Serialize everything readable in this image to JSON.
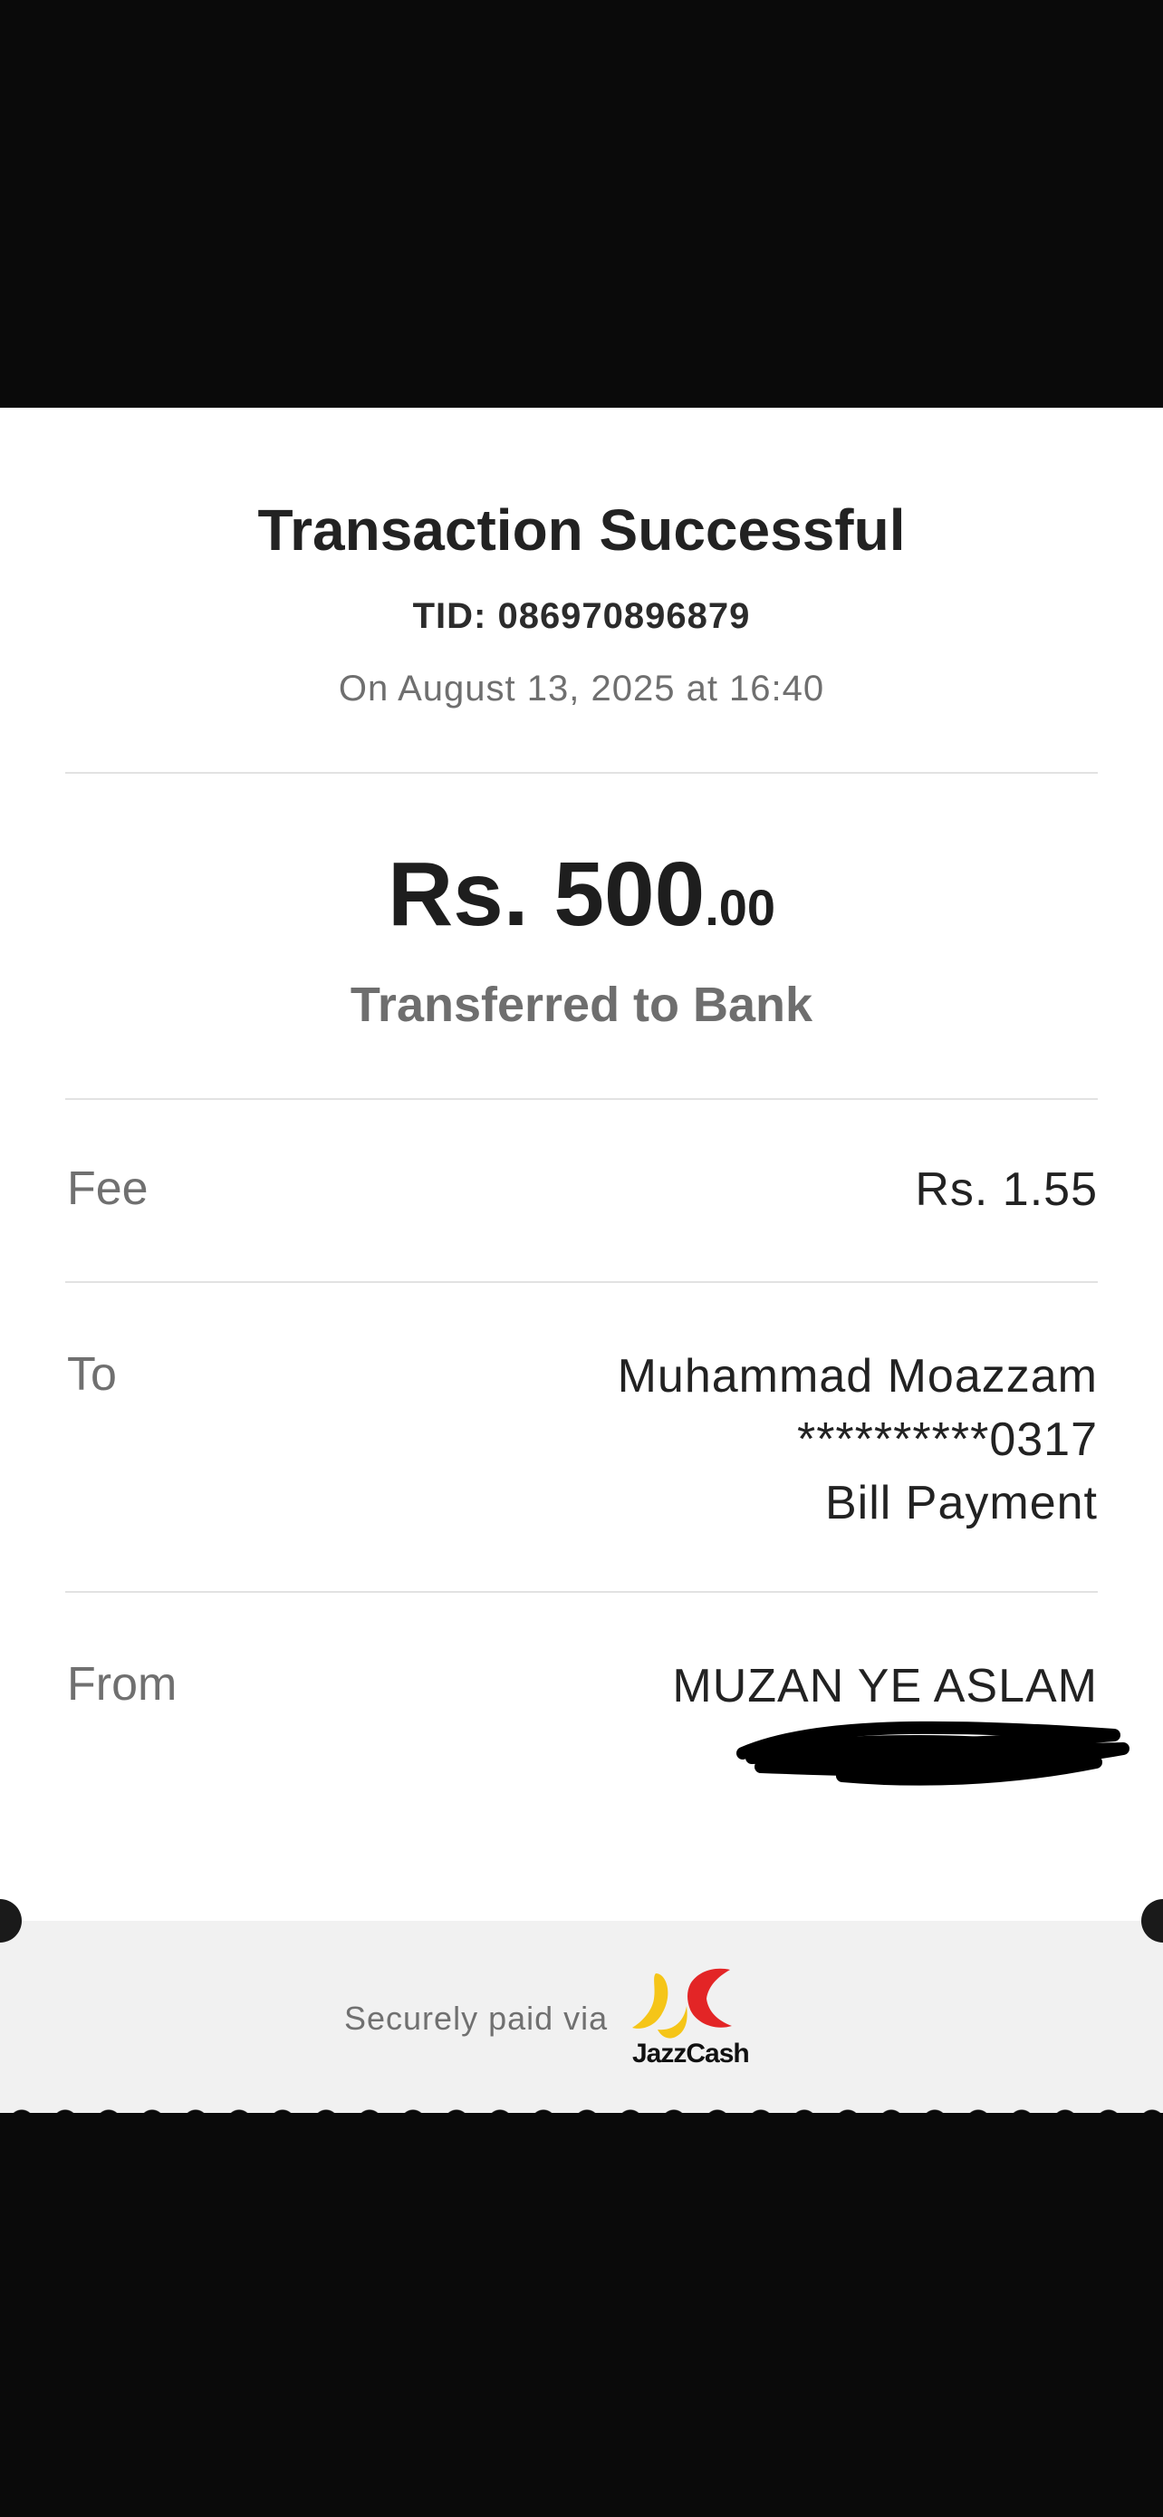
{
  "receipt": {
    "title": "Transaction Successful",
    "tid": "TID: 086970896879",
    "date": "On August 13, 2025 at 16:40",
    "amount_main": "Rs. 500",
    "amount_cents": ".00",
    "subtitle": "Transferred to Bank",
    "fee": {
      "label": "Fee",
      "value": "Rs. 1.55"
    },
    "to": {
      "label": "To",
      "name": "Muhammad Moazzam",
      "account": "**********0317",
      "type": "Bill Payment"
    },
    "from": {
      "label": "From",
      "name": "MUZAN YE ASLAM"
    }
  },
  "footer": {
    "secure_text": "Securely paid via",
    "brand": "JazzCash",
    "brand_colors": {
      "yellow": "#F5C518",
      "red": "#E32526"
    }
  }
}
